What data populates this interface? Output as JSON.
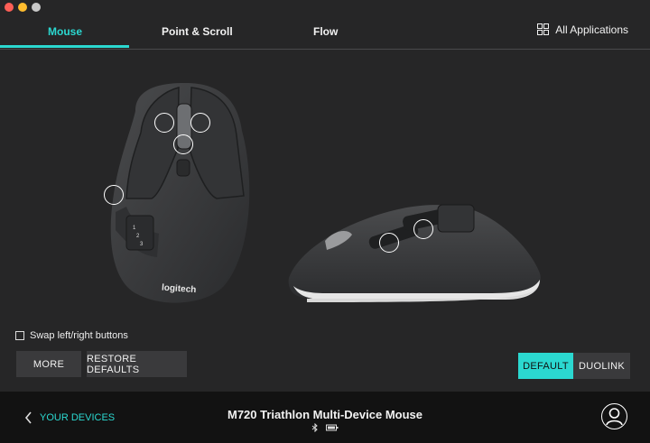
{
  "tabs": [
    {
      "label": "Mouse",
      "active": true
    },
    {
      "label": "Point & Scroll",
      "active": false
    },
    {
      "label": "Flow",
      "active": false
    }
  ],
  "all_applications_label": "All Applications",
  "mouse_logo": "logitech",
  "side_buttons": [
    "1",
    "2",
    "3"
  ],
  "swap_label": "Swap left/right buttons",
  "swap_checked": false,
  "more_label": "MORE",
  "restore_label": "RESTORE DEFAULTS",
  "default_label": "DEFAULT",
  "duolink_label": "DUOLINK",
  "footer": {
    "back_label": "YOUR DEVICES",
    "device_name": "M720 Triathlon Multi-Device Mouse",
    "status_icons": [
      "bluetooth-icon",
      "battery-icon"
    ]
  },
  "colors": {
    "accent": "#2bd8d0",
    "background": "#262627",
    "footer": "#121212"
  }
}
